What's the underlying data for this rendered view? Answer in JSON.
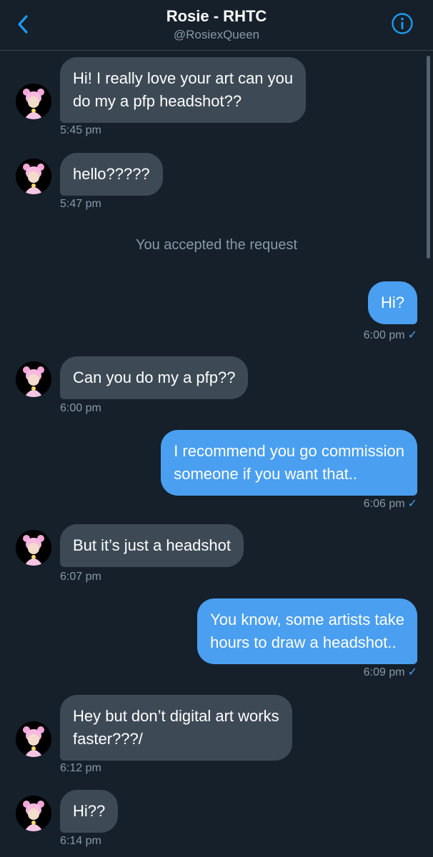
{
  "header": {
    "back_icon": "chevron-left-icon",
    "title": "Rosie - RHTC",
    "handle": "@RosiexQueen",
    "info_icon": "info-icon"
  },
  "conversation": {
    "system_message": "You accepted the request",
    "messages": [
      {
        "from": "them",
        "text_lines": [
          "Hi! I really love your art can you",
          "do my a pfp headshot??"
        ],
        "time": "5:45 pm"
      },
      {
        "from": "them",
        "text_lines": [
          "hello?????"
        ],
        "time": "5:47 pm"
      },
      {
        "from": "me",
        "text_lines": [
          "Hi?"
        ],
        "time": "6:00 pm",
        "read_mark": "✓"
      },
      {
        "from": "them",
        "text_lines": [
          "Can you do my a pfp??"
        ],
        "time": "6:00 pm"
      },
      {
        "from": "me",
        "text_lines": [
          "I recommend you go commission",
          "someone if you want that.."
        ],
        "time": "6:06 pm",
        "read_mark": "✓"
      },
      {
        "from": "them",
        "text_lines": [
          "But it’s just a headshot"
        ],
        "time": "6:07 pm"
      },
      {
        "from": "me",
        "text_lines": [
          "You know, some artists take",
          "hours to draw a headshot.."
        ],
        "time": "6:09 pm",
        "read_mark": "✓"
      },
      {
        "from": "them",
        "text_lines": [
          "Hey but don’t digital art works",
          "faster???/"
        ],
        "time": "6:12 pm"
      },
      {
        "from": "them",
        "text_lines": [
          "Hi??"
        ],
        "time": "6:14 pm"
      }
    ]
  },
  "colors": {
    "background": "#15202b",
    "incoming_bubble": "#3d4a56",
    "outgoing_bubble": "#4a9ff0",
    "accent": "#1d9bf0",
    "muted_text": "#8899a6"
  }
}
